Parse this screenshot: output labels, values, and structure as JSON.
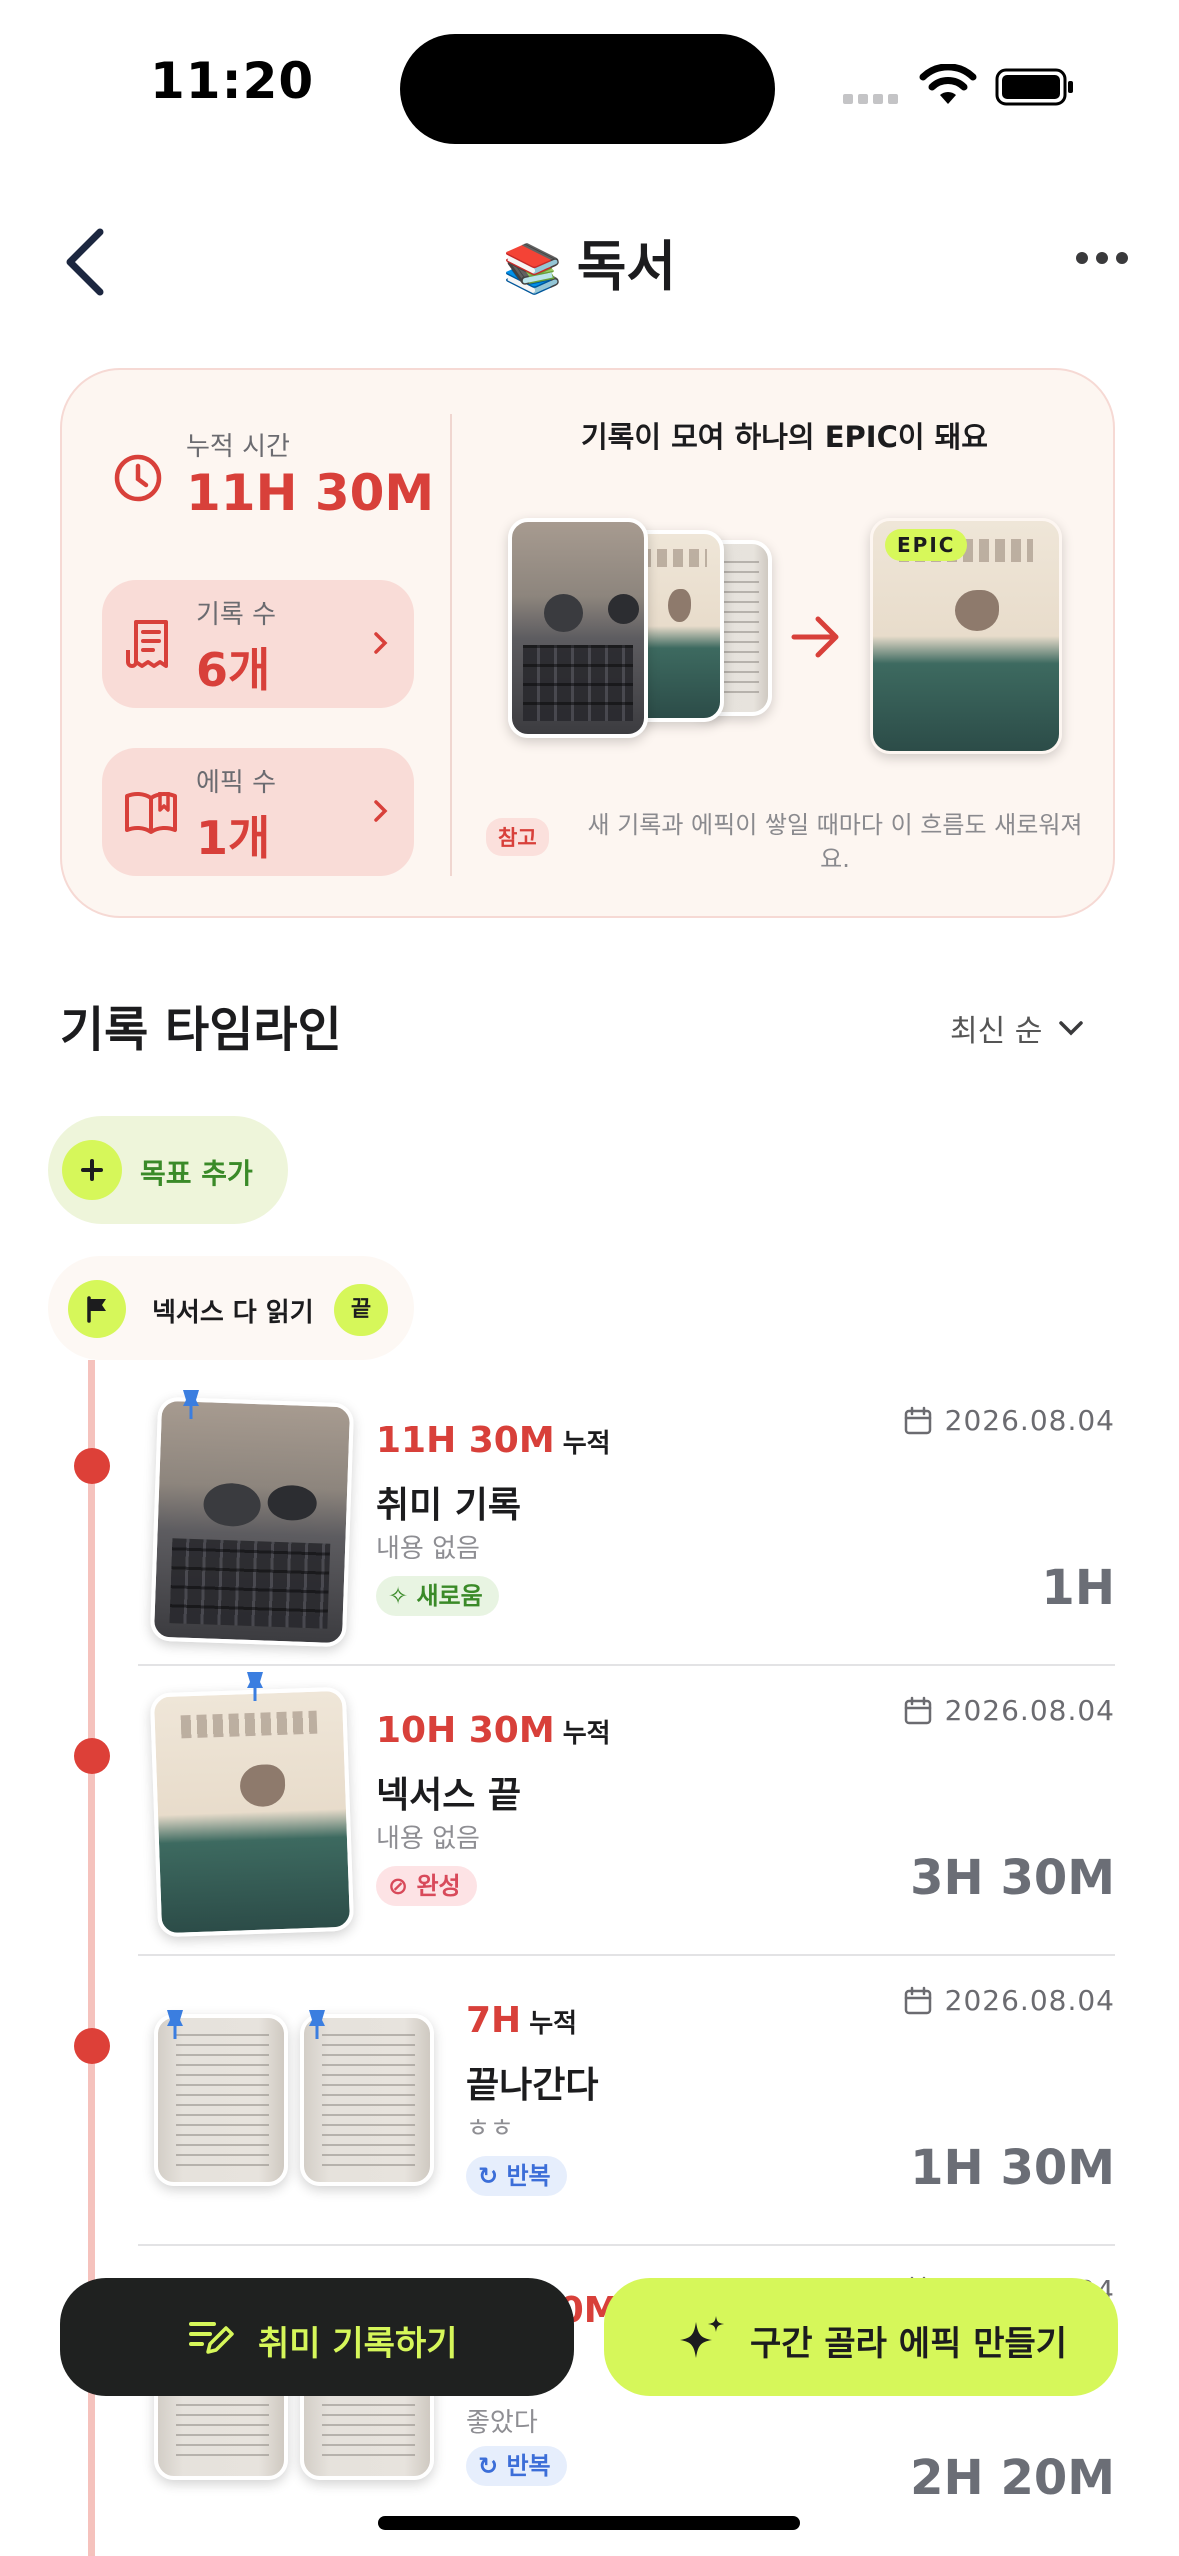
{
  "status_bar": {
    "time": "11:20"
  },
  "header": {
    "title_emoji": "📚",
    "title": "독서"
  },
  "summary": {
    "cumulative_label": "누적 시간",
    "cumulative_value": "11H 30M",
    "records_label": "기록 수",
    "records_value": "6개",
    "epics_label": "에픽 수",
    "epics_value": "1개",
    "epic_headline": "기록이 모여 하나의 EPIC이 돼요",
    "epic_tag": "EPIC",
    "note_badge": "참고",
    "note_text": "새 기록과 에픽이 쌓일 때마다 이 흐름도 새로워져요."
  },
  "timeline": {
    "title": "기록 타임라인",
    "sort_label": "최신 순",
    "add_goal_label": "목표 추가",
    "goal": {
      "label": "넥서스 다 읽기",
      "end_label": "끝"
    },
    "entries": [
      {
        "cum_value": "11H 30M",
        "cum_suffix": "누적",
        "title": "취미 기록",
        "sub": "내용 없음",
        "badge": "새로움",
        "badge_type": "new",
        "date": "2026.08.04",
        "duration": "1H"
      },
      {
        "cum_value": "10H 30M",
        "cum_suffix": "누적",
        "title": "넥서스 끝",
        "sub": "내용 없음",
        "badge": "완성",
        "badge_type": "done",
        "date": "2026.08.04",
        "duration": "3H 30M"
      },
      {
        "cum_value": "7H",
        "cum_suffix": "누적",
        "title": "끝나간다",
        "sub": "ㅎㅎ",
        "badge": "반복",
        "badge_type": "repeat",
        "date": "2026.08.04",
        "duration": "1H 30M"
      },
      {
        "cum_value": "5H 30M",
        "cum_suffix": "누적",
        "title": "",
        "sub": "좋았다",
        "badge": "반복",
        "badge_type": "repeat",
        "date": "2026.08.04",
        "duration": "2H 20M"
      }
    ]
  },
  "actions": {
    "record_label": "취미 기록하기",
    "epic_label": "구간 골라 에픽 만들기"
  },
  "colors": {
    "accent_red": "#d8403a",
    "accent_lime": "#d6f75a",
    "dark": "#1f2120"
  }
}
